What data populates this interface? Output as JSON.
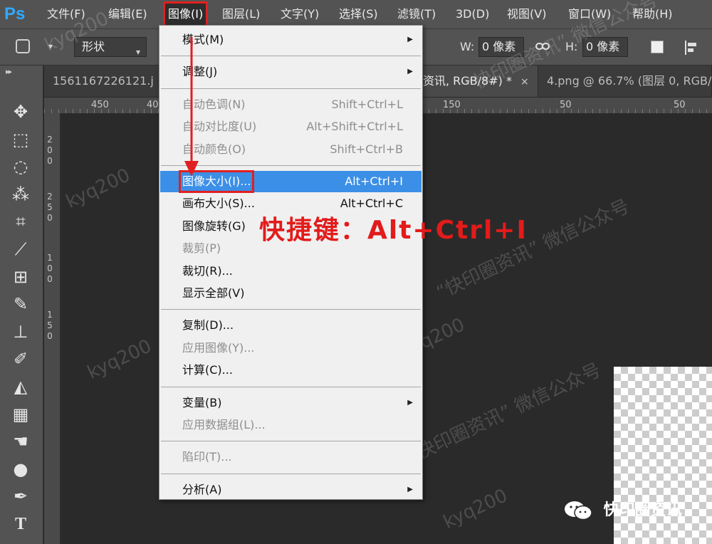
{
  "app": {
    "logo": "Ps"
  },
  "menubar": [
    {
      "label": "文件(F)",
      "active": false
    },
    {
      "label": "编辑(E)",
      "active": false
    },
    {
      "label": "图像(I)",
      "active": true
    },
    {
      "label": "图层(L)",
      "active": false
    },
    {
      "label": "文字(Y)",
      "active": false
    },
    {
      "label": "选择(S)",
      "active": false
    },
    {
      "label": "滤镜(T)",
      "active": false
    },
    {
      "label": "3D(D)",
      "active": false
    },
    {
      "label": "视图(V)",
      "active": false
    },
    {
      "label": "窗口(W)",
      "active": false
    },
    {
      "label": "帮助(H)",
      "active": false
    }
  ],
  "options": {
    "mode": "形状",
    "w_label": "W:",
    "w_value": "0 像素",
    "h_label": "H:",
    "h_value": "0 像素"
  },
  "tabs": [
    {
      "label": "1561167226121.j",
      "active": false,
      "close": ""
    },
    {
      "label": "资讯, RGB/8#) *",
      "active": true,
      "close": "×"
    },
    {
      "label": "4.png @ 66.7% (图层 0, RGB/",
      "active": false,
      "close": ""
    }
  ],
  "ruler": {
    "h": [
      "450",
      "40",
      "150",
      "50",
      "50"
    ],
    "v": [
      [
        "2",
        "0",
        "0"
      ],
      [
        "2",
        "5",
        "0"
      ],
      [
        "1",
        "0",
        "0"
      ],
      [
        "1",
        "5",
        "0"
      ]
    ]
  },
  "tools": [
    "move-icon",
    "marquee-icon",
    "lasso-icon",
    "magic-wand-icon",
    "crop-icon",
    "eyedropper-icon",
    "patch-icon",
    "brush-icon",
    "stamp-icon",
    "history-brush-icon",
    "eraser-icon",
    "gradient-icon",
    "smudge-icon",
    "dodge-icon",
    "pen-icon",
    "type-icon"
  ],
  "menu": {
    "items": [
      {
        "label": "模式(M)",
        "shortcut": "",
        "submenu": true,
        "disabled": false,
        "highlight": false
      },
      {
        "sep": true
      },
      {
        "label": "调整(J)",
        "shortcut": "",
        "submenu": true,
        "disabled": false,
        "highlight": false
      },
      {
        "sep": true
      },
      {
        "label": "自动色调(N)",
        "shortcut": "Shift+Ctrl+L",
        "submenu": false,
        "disabled": true,
        "highlight": false
      },
      {
        "label": "自动对比度(U)",
        "shortcut": "Alt+Shift+Ctrl+L",
        "submenu": false,
        "disabled": true,
        "highlight": false
      },
      {
        "label": "自动颜色(O)",
        "shortcut": "Shift+Ctrl+B",
        "submenu": false,
        "disabled": true,
        "highlight": false
      },
      {
        "sep": true
      },
      {
        "label": "图像大小(I)...",
        "shortcut": "Alt+Ctrl+I",
        "submenu": false,
        "disabled": false,
        "highlight": true
      },
      {
        "label": "画布大小(S)...",
        "shortcut": "Alt+Ctrl+C",
        "submenu": false,
        "disabled": false,
        "highlight": false
      },
      {
        "label": "图像旋转(G)",
        "shortcut": "",
        "submenu": false,
        "disabled": false,
        "highlight": false
      },
      {
        "label": "裁剪(P)",
        "shortcut": "",
        "submenu": false,
        "disabled": true,
        "highlight": false
      },
      {
        "label": "裁切(R)...",
        "shortcut": "",
        "submenu": false,
        "disabled": false,
        "highlight": false
      },
      {
        "label": "显示全部(V)",
        "shortcut": "",
        "submenu": false,
        "disabled": false,
        "highlight": false
      },
      {
        "sep": true
      },
      {
        "label": "复制(D)...",
        "shortcut": "",
        "submenu": false,
        "disabled": false,
        "highlight": false
      },
      {
        "label": "应用图像(Y)...",
        "shortcut": "",
        "submenu": false,
        "disabled": true,
        "highlight": false
      },
      {
        "label": "计算(C)...",
        "shortcut": "",
        "submenu": false,
        "disabled": false,
        "highlight": false
      },
      {
        "sep": true
      },
      {
        "label": "变量(B)",
        "shortcut": "",
        "submenu": true,
        "disabled": false,
        "highlight": false
      },
      {
        "label": "应用数据组(L)...",
        "shortcut": "",
        "submenu": false,
        "disabled": true,
        "highlight": false
      },
      {
        "sep": true
      },
      {
        "label": "陷印(T)...",
        "shortcut": "",
        "submenu": false,
        "disabled": true,
        "highlight": false
      },
      {
        "sep": true
      },
      {
        "label": "分析(A)",
        "shortcut": "",
        "submenu": true,
        "disabled": false,
        "highlight": false
      }
    ]
  },
  "annotation": {
    "text": "快捷键：Alt+Ctrl+I",
    "color": "#e21b1b"
  },
  "watermark": {
    "brand": "快印圈资讯",
    "marks": [
      "kyq200",
      "“快印圈资讯” 微信公众号",
      "kyq200",
      "“快印圈资讯” 微信公众号",
      "kyq200",
      "“快印圈资讯” 微信公众号",
      "kyq200",
      "kyq200"
    ]
  },
  "colors": {
    "accent": "#3c8fe6",
    "annotation": "#e02020",
    "ps_blue": "#31a8ff"
  }
}
